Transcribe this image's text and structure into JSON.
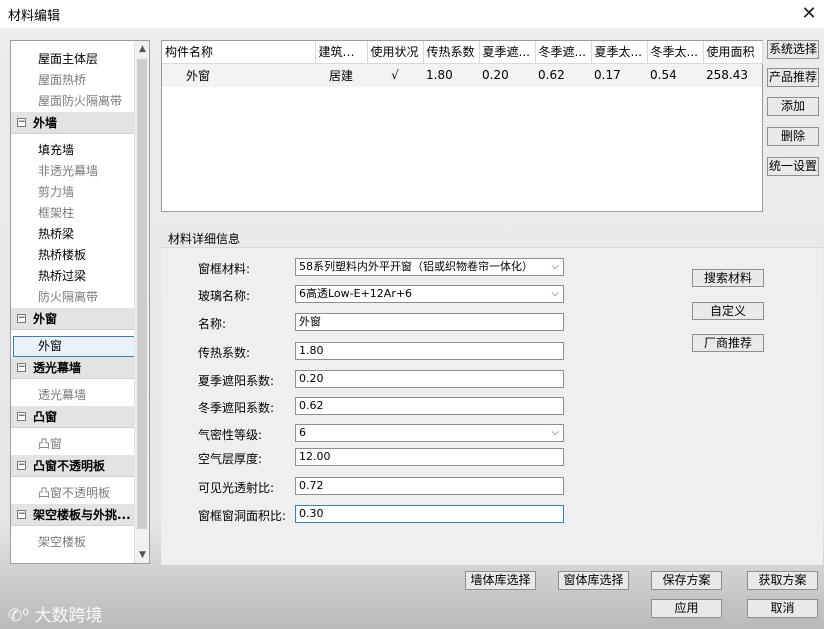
{
  "window": {
    "title": "材料编辑",
    "close_glyph": "✕"
  },
  "tree": {
    "items": [
      {
        "kind": "item",
        "label": "屋面主体层",
        "dim": false
      },
      {
        "kind": "item",
        "label": "屋面热桥",
        "dim": true
      },
      {
        "kind": "item",
        "label": "屋面防火隔离带",
        "dim": true
      },
      {
        "kind": "group",
        "label": "外墙"
      },
      {
        "kind": "item",
        "label": "填充墙",
        "dim": false
      },
      {
        "kind": "item",
        "label": "非透光幕墙",
        "dim": true
      },
      {
        "kind": "item",
        "label": "剪力墙",
        "dim": true
      },
      {
        "kind": "item",
        "label": "框架柱",
        "dim": true
      },
      {
        "kind": "item",
        "label": "热桥梁",
        "dim": false
      },
      {
        "kind": "item",
        "label": "热桥楼板",
        "dim": false
      },
      {
        "kind": "item",
        "label": "热桥过梁",
        "dim": false
      },
      {
        "kind": "item",
        "label": "防火隔离带",
        "dim": true
      },
      {
        "kind": "group",
        "label": "外窗"
      },
      {
        "kind": "item",
        "label": "外窗",
        "dim": false,
        "selected": true
      },
      {
        "kind": "group",
        "label": "透光幕墙"
      },
      {
        "kind": "item",
        "label": "透光幕墙",
        "dim": true
      },
      {
        "kind": "group",
        "label": "凸窗"
      },
      {
        "kind": "item",
        "label": "凸窗",
        "dim": true
      },
      {
        "kind": "group",
        "label": "凸窗不透明板"
      },
      {
        "kind": "item",
        "label": "凸窗不透明板",
        "dim": true
      },
      {
        "kind": "group",
        "label": "架空楼板与外挑..."
      },
      {
        "kind": "item",
        "label": "架空楼板",
        "dim": true
      }
    ],
    "collapse_glyph": "−"
  },
  "grid": {
    "columns": [
      "构件名称",
      "建筑屋...",
      "使用状况",
      "传热系数",
      "夏季遮...",
      "冬季遮...",
      "夏季太...",
      "冬季太...",
      "使用面积"
    ],
    "rows": [
      [
        "外窗",
        "居建",
        "√",
        "1.80",
        "0.20",
        "0.62",
        "0.17",
        "0.54",
        "258.43"
      ]
    ]
  },
  "side_buttons": [
    "系统选择",
    "产品推荐",
    "添加",
    "删除",
    "统一设置"
  ],
  "details": {
    "title": "材料详细信息",
    "fields": [
      {
        "label": "窗框材料:",
        "value": "58系列塑料内外平开窗（铝或织物卷帘一体化）",
        "dropdown": true
      },
      {
        "label": "玻璃名称:",
        "value": "6高透Low-E+12Ar+6",
        "dropdown": true
      },
      {
        "label": "名称:",
        "value": "外窗",
        "dropdown": false
      },
      {
        "label": "传热系数:",
        "value": "1.80",
        "dropdown": false
      },
      {
        "label": "夏季遮阳系数:",
        "value": "0.20",
        "dropdown": false
      },
      {
        "label": "冬季遮阳系数:",
        "value": "0.62",
        "dropdown": false
      },
      {
        "label": "气密性等级:",
        "value": "6",
        "dropdown": true
      },
      {
        "label": "空气层厚度:",
        "value": "12.00",
        "dropdown": false
      },
      {
        "label": "可见光透射比:",
        "value": "0.72",
        "dropdown": false
      },
      {
        "label": "窗框窗洞面积比:",
        "value": "0.30",
        "dropdown": false,
        "focused": true
      }
    ],
    "right_buttons": [
      "搜索材料",
      "自定义",
      "厂商推荐"
    ]
  },
  "bottom_buttons": {
    "wall_lib": "墙体库选择",
    "window_lib": "窗体库选择",
    "save_plan": "保存方案",
    "get_plan": "获取方案",
    "apply": "应用",
    "cancel": "取消"
  },
  "watermark": "大数跨境"
}
